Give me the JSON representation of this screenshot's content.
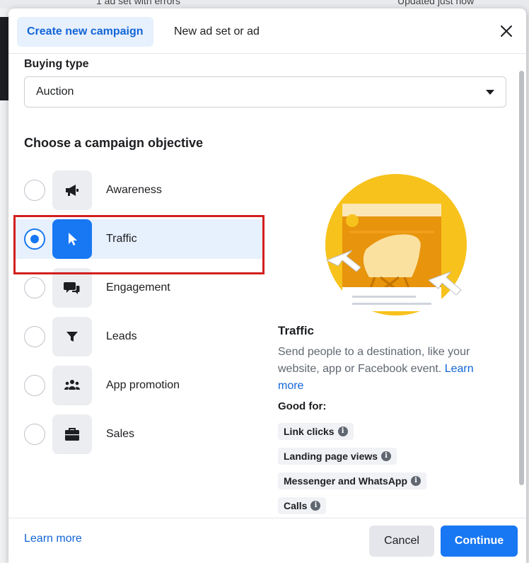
{
  "background": {
    "status_text": "1 ad set with errors",
    "updated_text": "Updated just now"
  },
  "header": {
    "tabs": [
      {
        "label": "Create new campaign",
        "active": true
      },
      {
        "label": "New ad set or ad",
        "active": false
      }
    ],
    "close_icon": "close-icon"
  },
  "buying_type": {
    "label": "Buying type",
    "value": "Auction"
  },
  "objective": {
    "title": "Choose a campaign objective",
    "options": [
      {
        "label": "Awareness",
        "icon": "megaphone-icon",
        "selected": false
      },
      {
        "label": "Traffic",
        "icon": "cursor-icon",
        "selected": true
      },
      {
        "label": "Engagement",
        "icon": "chat-bubbles-icon",
        "selected": false
      },
      {
        "label": "Leads",
        "icon": "funnel-icon",
        "selected": false
      },
      {
        "label": "App promotion",
        "icon": "people-icon",
        "selected": false
      },
      {
        "label": "Sales",
        "icon": "briefcase-icon",
        "selected": false
      }
    ]
  },
  "detail": {
    "title": "Traffic",
    "description": "Send people to a destination, like your website, app or Facebook event.",
    "learn_more": "Learn more",
    "good_for_label": "Good for:",
    "good_for": [
      "Link clicks",
      "Landing page views",
      "Messenger and WhatsApp",
      "Calls"
    ]
  },
  "footer": {
    "learn_more": "Learn more",
    "cancel": "Cancel",
    "continue": "Continue"
  },
  "colors": {
    "accent": "#1877f2",
    "accent_bg": "#e7f0fd",
    "highlight": "#d21f1f",
    "illustration_yellow": "#f7c21c",
    "illustration_orange": "#e8940c"
  }
}
